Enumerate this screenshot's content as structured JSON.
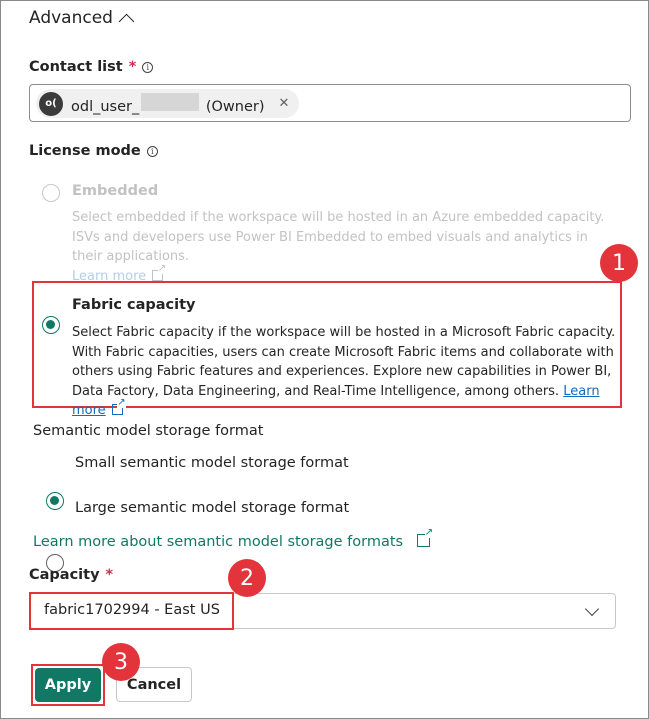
{
  "advanced": {
    "title": "Advanced"
  },
  "contact_list": {
    "label": "Contact list",
    "required_mark": "*",
    "info_glyph": "i",
    "chip": {
      "avatar_initials": "o(",
      "name_prefix": "odl_user_",
      "role": "(Owner)",
      "remove_glyph": "✕"
    }
  },
  "license_mode": {
    "label": "License mode",
    "info_glyph": "i",
    "options": [
      {
        "title": "Embedded",
        "description": "Select embedded if the workspace will be hosted in an Azure embedded capacity. ISVs and developers use Power BI Embedded to embed visuals and analytics in their applications.",
        "link": "Learn more",
        "selected": false,
        "disabled": true
      },
      {
        "title": "Fabric capacity",
        "description": "Select Fabric capacity if the workspace will be hosted in a Microsoft Fabric capacity. With Fabric capacities, users can create Microsoft Fabric items and collaborate with others using Fabric features and experiences. Explore new capabilities in Power BI, Data Factory, Data Engineering, and Real-Time Intelligence, among others.",
        "link": "Learn more",
        "selected": true,
        "disabled": false
      }
    ]
  },
  "storage_format": {
    "label": "Semantic model storage format",
    "options": [
      {
        "label": "Small semantic model storage format",
        "selected": true
      },
      {
        "label": "Large semantic model storage format",
        "selected": false
      }
    ],
    "learn_more": "Learn more about semantic model storage formats"
  },
  "capacity": {
    "label": "Capacity",
    "required_mark": "*",
    "selected": "fabric1702994 - East US"
  },
  "actions": {
    "apply": "Apply",
    "cancel": "Cancel"
  },
  "callouts": [
    "1",
    "2",
    "3"
  ],
  "colors": {
    "accent": "#117865",
    "highlight": "#e3333b",
    "link": "#0f6cbd"
  }
}
